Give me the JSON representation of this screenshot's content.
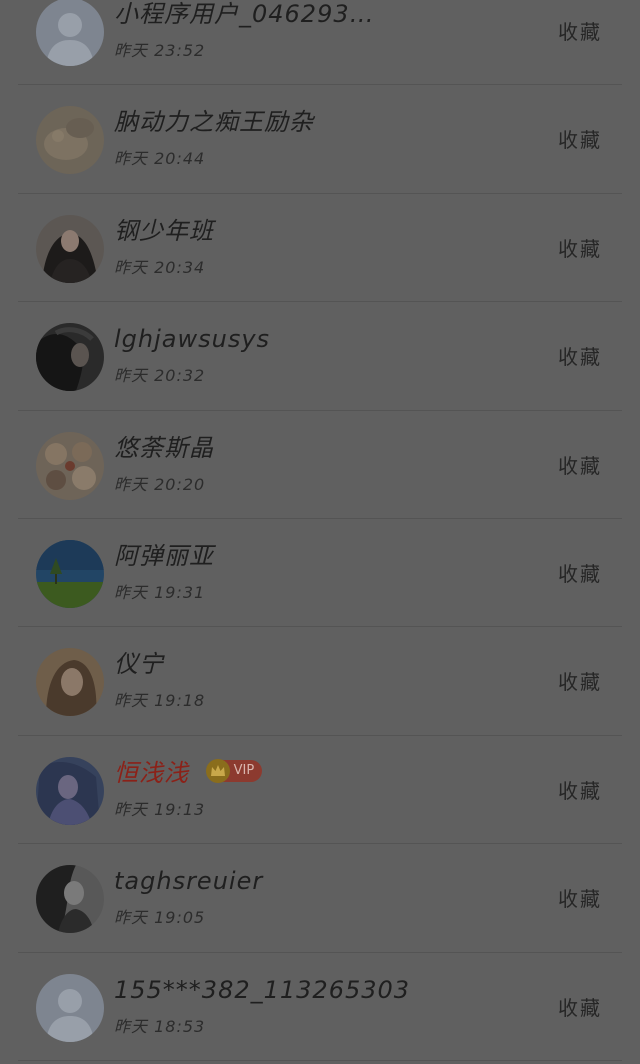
{
  "users": [
    {
      "name": "小程序用户_046293…",
      "time": "昨天 23:52",
      "action": "收藏",
      "avatar": "default-avatar-icon",
      "vip": false
    },
    {
      "name": "肭动力之痴王励杂",
      "time": "昨天 20:44",
      "action": "收藏",
      "avatar": "photo",
      "vip": false
    },
    {
      "name": "钢少年班",
      "time": "昨天 20:34",
      "action": "收藏",
      "avatar": "photo",
      "vip": false
    },
    {
      "name": "lghjawsusys",
      "time": "昨天 20:32",
      "action": "收藏",
      "avatar": "photo",
      "vip": false
    },
    {
      "name": "悠荼斯晶",
      "time": "昨天 20:20",
      "action": "收藏",
      "avatar": "photo",
      "vip": false
    },
    {
      "name": "阿弹丽亚",
      "time": "昨天 19:31",
      "action": "收藏",
      "avatar": "photo",
      "vip": false
    },
    {
      "name": "仪宁",
      "time": "昨天 19:18",
      "action": "收藏",
      "avatar": "photo",
      "vip": false
    },
    {
      "name": "恒浅浅",
      "time": "昨天 19:13",
      "action": "收藏",
      "avatar": "photo",
      "vip": true,
      "vip_label": "VIP"
    },
    {
      "name": "taghsreuier",
      "time": "昨天 19:05",
      "action": "收藏",
      "avatar": "photo",
      "vip": false
    },
    {
      "name": "155***382_113265303",
      "time": "昨天 18:53",
      "action": "收藏",
      "avatar": "default-avatar-icon",
      "vip": false
    }
  ],
  "colors": {
    "overlay_background": "#606060",
    "vip_name": "#8b2118",
    "vip_badge": "#8c3a2f"
  }
}
